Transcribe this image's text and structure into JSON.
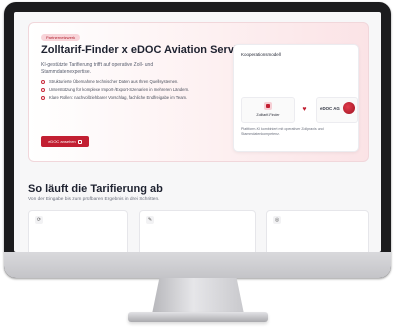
{
  "hero": {
    "badge": "Partnernetzwerk",
    "title": "Zolltarif-Finder x eDOC Aviation Service",
    "subtitle": "KI-gestützte Tarifierung trifft auf operative Zoll- und Stammdatenexpertise.",
    "bullets": [
      "Strukturierte Übernahme technischer Daten aus Ihren Quellsystemen.",
      "Unterstützung für komplexe Import-/Export-Szenarien in mehreren Ländern.",
      "Klare Rollen: nachvollziehbarer Vorschlag, fachliche Endfreigabe im Team."
    ],
    "cta_label": "eDOC ansehen"
  },
  "cooperation": {
    "title": "Kooperationsmodell",
    "partner_left": "Zolltarif-Finder",
    "partner_right": "eDOC AG",
    "description": "Plattform-KI kombiniert mit operativer Zollpraxis und Stammdatenkompetenz."
  },
  "steps": {
    "title": "So läuft die Tarifierung ab",
    "subtitle": "Von der Eingabe bis zum prüfbaren Ergebnis in drei Schritten.",
    "icons": [
      "refresh-icon",
      "edit-icon",
      "target-icon"
    ]
  },
  "colors": {
    "accent": "#c21f32",
    "heading": "#1e2230"
  }
}
